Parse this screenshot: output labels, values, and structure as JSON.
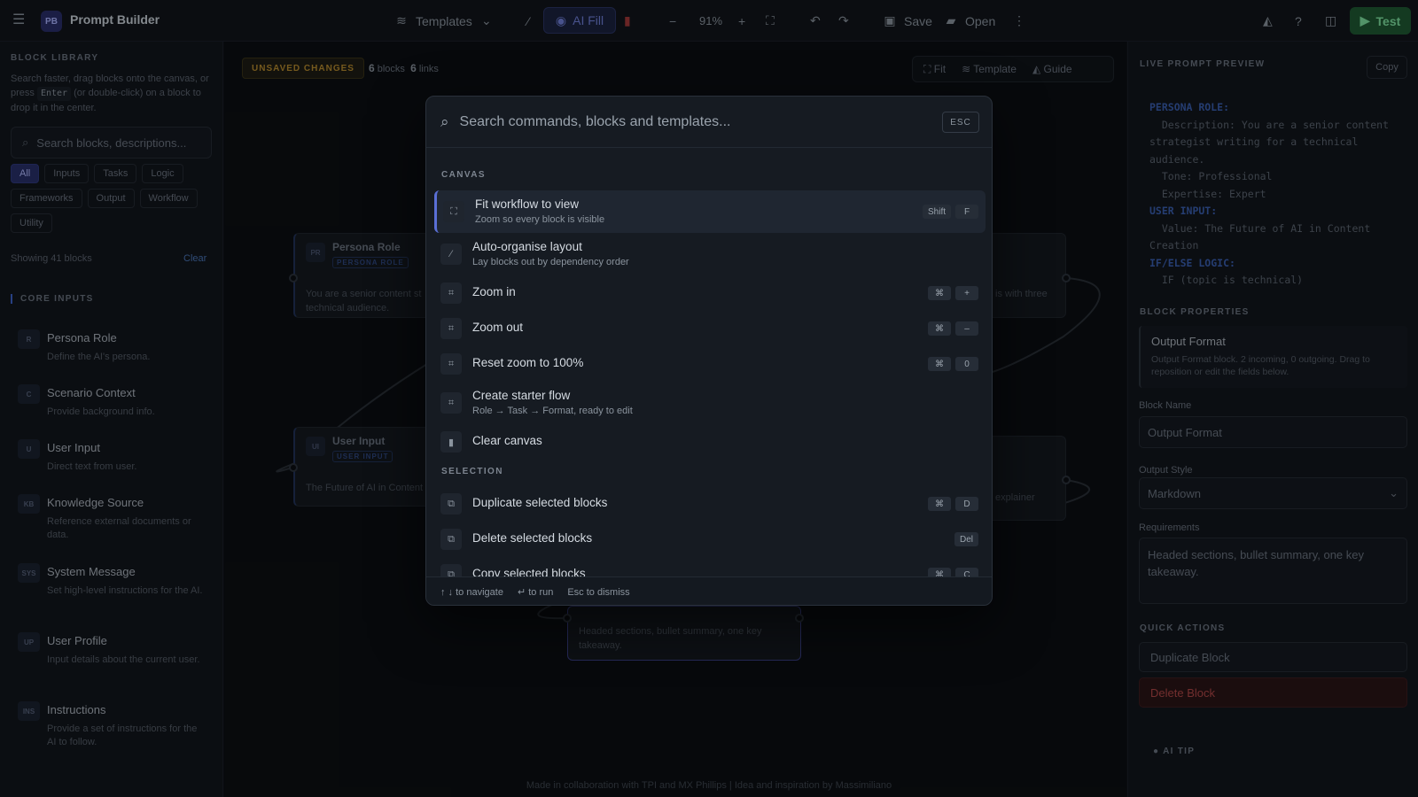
{
  "topbar": {
    "app_logo": "PB",
    "app_title": "Prompt Builder",
    "templates_label": "Templates",
    "ai_fill_label": "AI Fill",
    "zoom_level": "91%",
    "save_label": "Save",
    "open_label": "Open",
    "test_label": "Test"
  },
  "sidebar": {
    "section_title": "BLOCK LIBRARY",
    "description_before": "Search faster, drag blocks onto the canvas, or press",
    "description_key": "Enter",
    "description_after": "(or double-click) on a block to drop it in the center.",
    "search_placeholder": "Search blocks, descriptions...",
    "chips": [
      "All",
      "Inputs",
      "Tasks",
      "Logic",
      "Frameworks",
      "Output",
      "Workflow",
      "Utility"
    ],
    "active_chip": "All",
    "showing_text": "Showing 41 blocks",
    "clear_label": "Clear",
    "group_title": "CORE INPUTS",
    "items": [
      {
        "badge": "R",
        "name": "Persona Role",
        "desc": "Define the AI's persona."
      },
      {
        "badge": "C",
        "name": "Scenario Context",
        "desc": "Provide background info."
      },
      {
        "badge": "U",
        "name": "User Input",
        "desc": "Direct text from user."
      },
      {
        "badge": "KB",
        "name": "Knowledge Source",
        "desc": "Reference external documents or data."
      },
      {
        "badge": "SYS",
        "name": "System Message",
        "desc": "Set high-level instructions for the AI."
      },
      {
        "badge": "UP",
        "name": "User Profile",
        "desc": "Input details about the current user."
      },
      {
        "badge": "INS",
        "name": "Instructions",
        "desc": "Provide a set of instructions for the AI to follow."
      }
    ]
  },
  "canvas": {
    "unsaved_label": "UNSAVED CHANGES",
    "blocks_count": "6",
    "blocks_label": "blocks",
    "links_count": "6",
    "links_label": "links",
    "fit_label": "Fit",
    "template_label": "Template",
    "guide_label": "Guide",
    "nodes": [
      {
        "badge": "PR",
        "title": "Persona Role",
        "tag": "PERSONA ROLE",
        "text_1": "You are a senior content st",
        "text_2": "technical audience."
      },
      {
        "badge": "UI",
        "title": "User Input",
        "tag": "USER INPUT",
        "text_1": "The Future of AI in Content"
      },
      {
        "text_1": "is with three"
      },
      {
        "text_1": "explainer"
      },
      {
        "text_1": "Headed sections, bullet summary, one key",
        "text_2": "takeaway."
      }
    ],
    "credit": "Made in collaboration with TPI and MX Phillips | Idea and inspiration by Massimiliano"
  },
  "right_panel": {
    "preview_title": "LIVE PROMPT PREVIEW",
    "copy_label": "Copy",
    "preview_lines": [
      {
        "key": "PERSONA ROLE:",
        "text": ""
      },
      {
        "key": "",
        "text": "  Description: You are a senior content"
      },
      {
        "key": "",
        "text": "strategist writing for a technical"
      },
      {
        "key": "",
        "text": "audience."
      },
      {
        "key": "",
        "text": "  Tone: Professional"
      },
      {
        "key": "",
        "text": "  Expertise: Expert"
      },
      {
        "key": "USER INPUT:",
        "text": ""
      },
      {
        "key": "",
        "text": "  Value: The Future of AI in Content"
      },
      {
        "key": "",
        "text": "Creation"
      },
      {
        "key": "IF/ELSE LOGIC:",
        "text": ""
      },
      {
        "key": "",
        "text": "  IF (topic is technical)"
      }
    ],
    "props_title": "BLOCK PROPERTIES",
    "card_title": "Output Format",
    "card_desc": "Output Format block. 2 incoming, 0 outgoing. Drag to reposition or edit the fields below.",
    "block_name_label": "Block Name",
    "block_name_value": "Output Format",
    "output_style_label": "Output Style",
    "output_style_value": "Markdown",
    "requirements_label": "Requirements",
    "requirements_value": "Headed sections, bullet summary, one key takeaway.",
    "quick_actions_title": "QUICK ACTIONS",
    "duplicate_label": "Duplicate Block",
    "delete_label": "Delete Block",
    "ai_tip_label": "AI TIP"
  },
  "palette": {
    "search_placeholder": "Search commands, blocks and templates...",
    "esc_label": "ESC",
    "groups": {
      "canvas": "CANVAS",
      "selection": "SELECTION"
    },
    "commands": [
      {
        "title": "Fit workflow to view",
        "sub": "Zoom so every block is visible",
        "keys": [
          "Shift",
          "F"
        ]
      },
      {
        "title": "Auto-organise layout",
        "sub": "Lay blocks out by dependency order",
        "keys": []
      },
      {
        "title": "Zoom in",
        "sub": "",
        "keys": [
          "⌘",
          "+"
        ]
      },
      {
        "title": "Zoom out",
        "sub": "",
        "keys": [
          "⌘",
          "–"
        ]
      },
      {
        "title": "Reset zoom to 100%",
        "sub": "",
        "keys": [
          "⌘",
          "0"
        ]
      },
      {
        "title": "Create starter flow",
        "sub": "Role → Task → Format, ready to edit",
        "keys": []
      },
      {
        "title": "Clear canvas",
        "sub": "",
        "keys": []
      },
      {
        "title": "Duplicate selected blocks",
        "sub": "",
        "keys": [
          "⌘",
          "D"
        ]
      },
      {
        "title": "Delete selected blocks",
        "sub": "",
        "keys": [
          "Del"
        ]
      },
      {
        "title": "Copy selected blocks",
        "sub": "",
        "keys": [
          "⌘",
          "C"
        ]
      }
    ],
    "footer": {
      "navigate": "↑ ↓ to navigate",
      "run": "↵ to run",
      "dismiss": "Esc to dismiss"
    }
  }
}
